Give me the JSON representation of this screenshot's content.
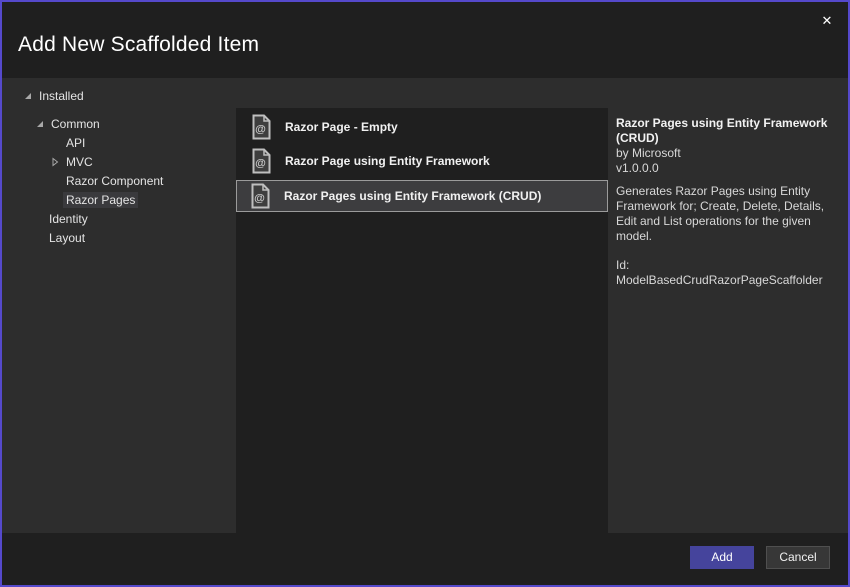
{
  "dialog": {
    "title": "Add New Scaffolded Item",
    "close_glyph": "✕"
  },
  "tree": {
    "items": [
      {
        "label": "Installed",
        "level": 0,
        "expander": "expanded"
      },
      {
        "label": "Common",
        "level": 1,
        "expander": "expanded"
      },
      {
        "label": "API",
        "level": 2,
        "expander": "none"
      },
      {
        "label": "MVC",
        "level": 2,
        "expander": "collapsed"
      },
      {
        "label": "Razor Component",
        "level": 2,
        "expander": "none"
      },
      {
        "label": "Razor Pages",
        "level": 2,
        "expander": "none",
        "selected": true
      },
      {
        "label": "Identity",
        "level": 1,
        "expander": "none"
      },
      {
        "label": "Layout",
        "level": 1,
        "expander": "none"
      }
    ]
  },
  "list": {
    "items": [
      {
        "label": "Razor Page - Empty",
        "icon": "razor-page-icon",
        "selected": false
      },
      {
        "label": "Razor Page using Entity Framework",
        "icon": "razor-page-icon",
        "selected": false
      },
      {
        "label": "Razor Pages using Entity Framework (CRUD)",
        "icon": "razor-page-icon",
        "selected": true
      }
    ]
  },
  "details": {
    "title": "Razor Pages using Entity Framework (CRUD)",
    "author": "by Microsoft",
    "version": "v1.0.0.0",
    "description": "Generates Razor Pages using Entity Framework for; Create, Delete, Details, Edit and List operations for the given model.",
    "id_line": "Id: ModelBasedCrudRazorPageScaffolder"
  },
  "footer": {
    "add_label": "Add",
    "cancel_label": "Cancel"
  },
  "colors": {
    "accent_border": "#5549cb",
    "add_button": "#45449c",
    "panel_bg": "#2d2d2d",
    "dark_bg": "#1f1f1f",
    "selection_border": "#9b9b9b",
    "selection_bg": "#3d3d3f",
    "tree_selection_bg": "#3a3a3d"
  }
}
